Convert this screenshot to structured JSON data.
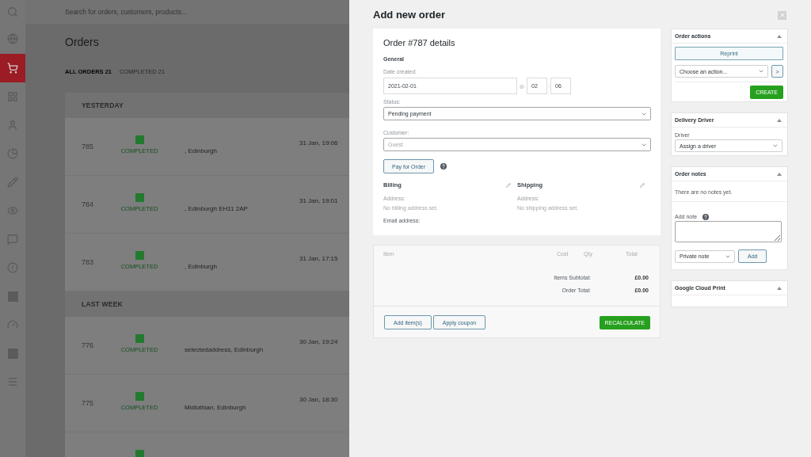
{
  "background": {
    "sidebar": {
      "items": [
        {
          "selected": false
        },
        {
          "selected": false
        },
        {
          "selected": true
        },
        {
          "selected": false
        },
        {
          "selected": false
        },
        {
          "selected": false
        },
        {
          "selected": false
        },
        {
          "selected": false
        },
        {
          "selected": false
        },
        {
          "selected": false
        },
        {
          "selected": false
        },
        {
          "selected": false
        },
        {
          "selected": false
        },
        {
          "selected": false
        }
      ]
    },
    "search": {
      "placeholder": "Search for orders, customers, products..."
    },
    "title": "Orders",
    "tabs": [
      {
        "label": "ALL ORDERS 21",
        "selected": true
      },
      {
        "label": "COMPLETED 21",
        "selected": false
      }
    ],
    "groups": [
      {
        "heading": "YESTERDAY",
        "orders": [
          {
            "kind": "full",
            "number": "785",
            "status": "COMPLETED",
            "address": ", Edinburgh",
            "date": "31 Jan, 19:06"
          },
          {
            "kind": "full",
            "number": "784",
            "status": "COMPLETED",
            "address": ", Edinburgh EH11 2AP",
            "date": "31 Jan, 19:01"
          },
          {
            "kind": "full",
            "number": "783",
            "status": "COMPLETED",
            "address": ", Edinburgh",
            "date": "31 Jan, 17:15"
          }
        ]
      },
      {
        "heading": "LAST WEEK",
        "orders": [
          {
            "kind": "full",
            "number": "776",
            "status": "COMPLETED",
            "address": "selectedaddress, Edinburgh",
            "date": "30 Jan, 19:24"
          },
          {
            "kind": "full",
            "number": "775",
            "status": "COMPLETED",
            "address": "Midlothian, Edinburgh",
            "date": "30 Jan, 18:30"
          },
          {
            "kind": "partial"
          }
        ]
      }
    ]
  },
  "modal": {
    "title": "Add new order",
    "details": {
      "heading": "Order #787 details",
      "section": "General",
      "date_label": "Date created:",
      "date": "2021-02-01",
      "at": "@",
      "hour": "02",
      "separator": ":",
      "minute": "06",
      "status_label": "Status:",
      "status": "Pending payment",
      "customer_label": "Customer:",
      "customer_placeholder": "Guest",
      "pay_button": "Pay for Order",
      "addresses": [
        {
          "heading": "Billing",
          "address_label": "Address:",
          "address": "No billing address set.",
          "email_label": "Email address:"
        },
        {
          "heading": "Shipping",
          "address_label": "Address:",
          "address": "No shipping address set."
        }
      ]
    },
    "items": {
      "columns": [
        "Item",
        "Cost",
        "Qty",
        "Total"
      ],
      "totals": [
        {
          "label": "Items Subtotal:",
          "value": "£0.00"
        },
        {
          "label": "Order Total:",
          "value": "£0.00"
        }
      ],
      "buttons": [
        "Add item(s)",
        "Apply coupon"
      ],
      "recalculate_button": "RECALCULATE"
    },
    "panels": [
      {
        "kind": "actions",
        "title": "Order actions",
        "expanded": true,
        "reprint_button": "Reprint",
        "action": "Choose an action...",
        "go_button": ">",
        "create_button": "CREATE"
      },
      {
        "kind": "driver",
        "title": "Delivery Driver",
        "expanded": true,
        "label": "Driver",
        "value": "Assign a driver"
      },
      {
        "kind": "notes",
        "title": "Order notes",
        "expanded": true,
        "empty_text": "There are no notes yet.",
        "add_label": "Add note",
        "note_type": "Private note",
        "add_button": "Add"
      },
      {
        "kind": "plain",
        "title": "Google Cloud Print",
        "expanded": true
      }
    ]
  }
}
